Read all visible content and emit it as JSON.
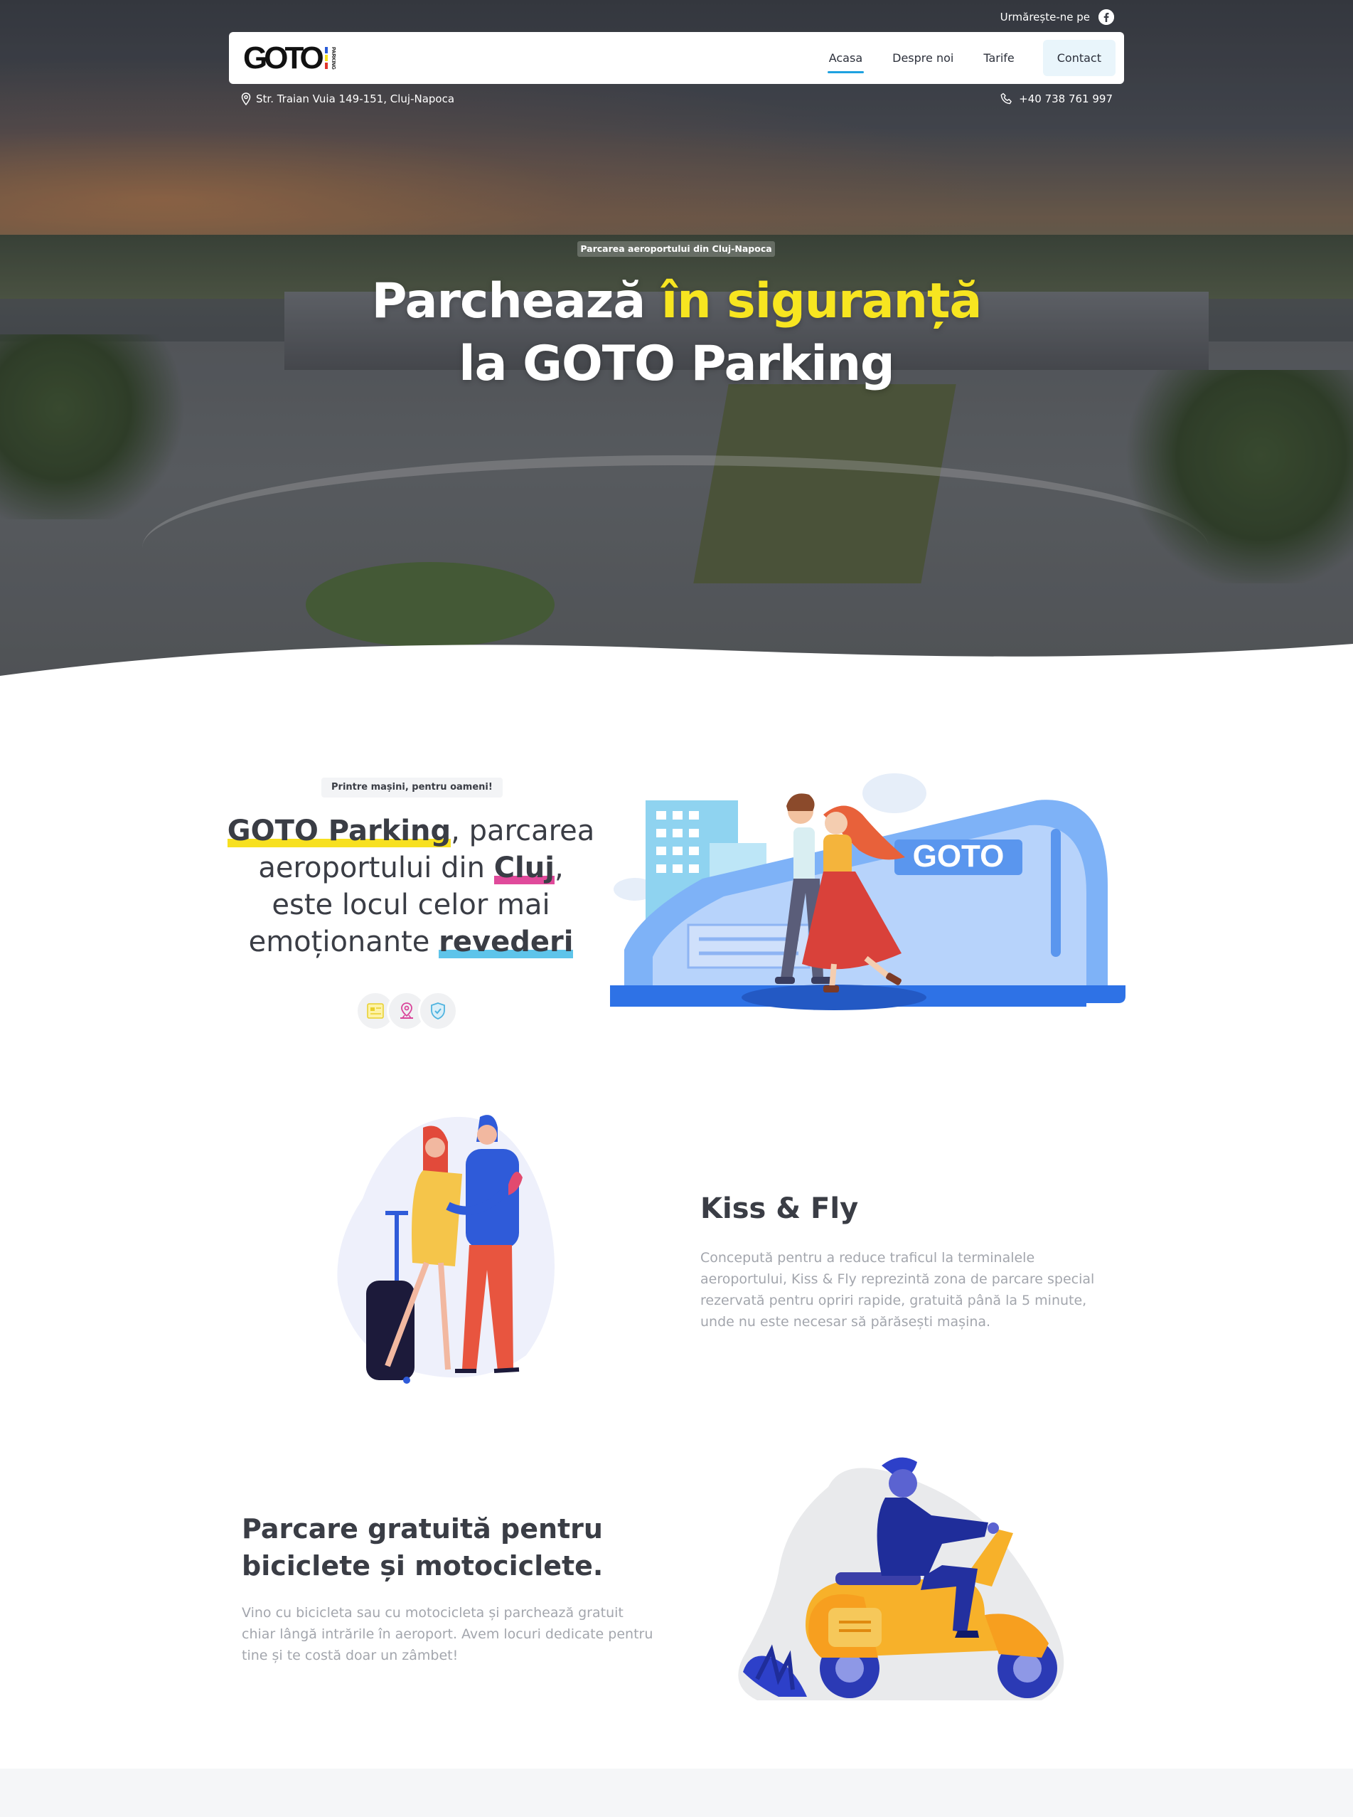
{
  "header": {
    "follow_label": "Urmărește-ne pe",
    "follow_icon": "facebook-icon",
    "logo_text": "GOTO",
    "logo_sub": "PARKING",
    "nav": [
      {
        "label": "Acasa",
        "active": true
      },
      {
        "label": "Despre noi",
        "active": false
      },
      {
        "label": "Tarife",
        "active": false
      },
      {
        "label": "Contact",
        "active": false
      }
    ],
    "address": "Str. Traian Vuia 149-151, Cluj-Napoca",
    "address_icon": "map-pin-icon",
    "phone": "+40 738 761 997",
    "phone_icon": "phone-icon"
  },
  "hero": {
    "badge": "Parcarea aeroportului din Cluj-Napoca",
    "title_part1": "Parchează ",
    "title_highlight": "în siguranță",
    "title_line2": "la GOTO Parking"
  },
  "intro": {
    "chip": "Printre mașini, pentru oameni!",
    "brand": "GOTO Parking",
    "text_a": ", parcarea aeroportului din ",
    "city": "Cluj",
    "text_b": ", este locul celor mai emoționante ",
    "last": "revederi",
    "icons": [
      "ticket-icon",
      "location-icon",
      "shield-check-icon"
    ],
    "illustration_sign": "GOTO"
  },
  "kiss_fly": {
    "title": "Kiss & Fly",
    "text": "Concepută pentru a reduce traficul la terminalele aeroportului, Kiss & Fly reprezintă zona de parcare special rezervată pentru opriri rapide, gratuită până la 5 minute, unde nu este necesar să părăsești mașina."
  },
  "bikes": {
    "title": "Parcare gratuită pentru biciclete și motociclete.",
    "text": "Vino cu bicicleta sau cu motocicleta și parchează gratuit chiar lângă intrările în aeroport. Avem locuri dedicate pentru tine și te costă doar un zâmbet!"
  },
  "colors": {
    "accent_yellow": "#f7e520",
    "accent_pink": "#e04a9b",
    "accent_blue": "#5ec4ea",
    "nav_underline": "#1ea1e0",
    "text_dark": "#3a3d45",
    "text_muted": "#a3a6ad"
  }
}
